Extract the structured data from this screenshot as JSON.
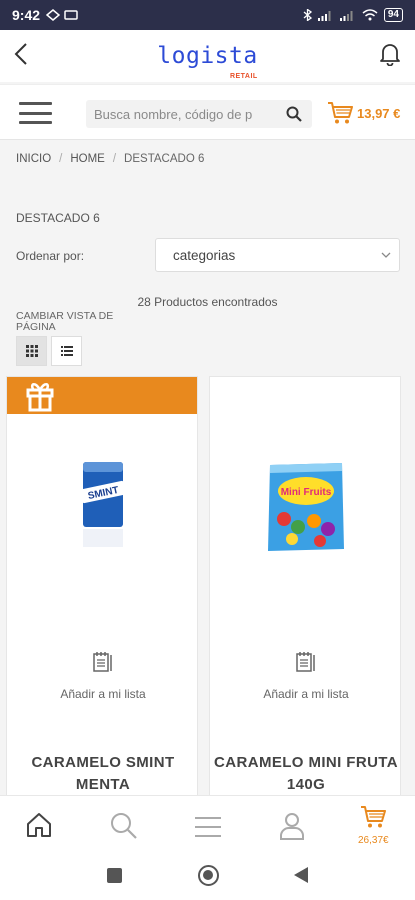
{
  "status_bar": {
    "time": "9:42",
    "battery": "94"
  },
  "header": {
    "logo_text": "logista",
    "logo_subtext": "RETAIL"
  },
  "search": {
    "placeholder": "Busca nombre, código de p"
  },
  "cart": {
    "total_top": "13,97 €",
    "total_bottom": "26,37€"
  },
  "breadcrumb": [
    "INICIO",
    "HOME",
    "DESTACADO 6"
  ],
  "page_title": "DESTACADO 6",
  "sort": {
    "label": "Ordenar por:",
    "value": "categorias"
  },
  "results_count": "28 Productos encontrados",
  "view_toggle_label": "CAMBIAR VISTA DE PÁGINA",
  "products": [
    {
      "name": "CARAMELO SMINT MENTA",
      "add_label": "Añadir a mi lista",
      "img_text": "SMINT"
    },
    {
      "name": "CARAMELO MINI FRUTA 140G",
      "add_label": "Añadir a mi lista",
      "img_text": "Mini Fruits"
    }
  ],
  "colors": {
    "accent": "#e8891e",
    "brand_blue": "#2d4bd6",
    "status_bar": "#2c2f4a"
  },
  "icons": [
    "back-arrow-icon",
    "bell-icon",
    "hamburger-icon",
    "search-icon",
    "cart-icon",
    "grid-icon",
    "list-icon",
    "gift-icon",
    "shopping-list-icon",
    "home-icon",
    "user-icon"
  ]
}
